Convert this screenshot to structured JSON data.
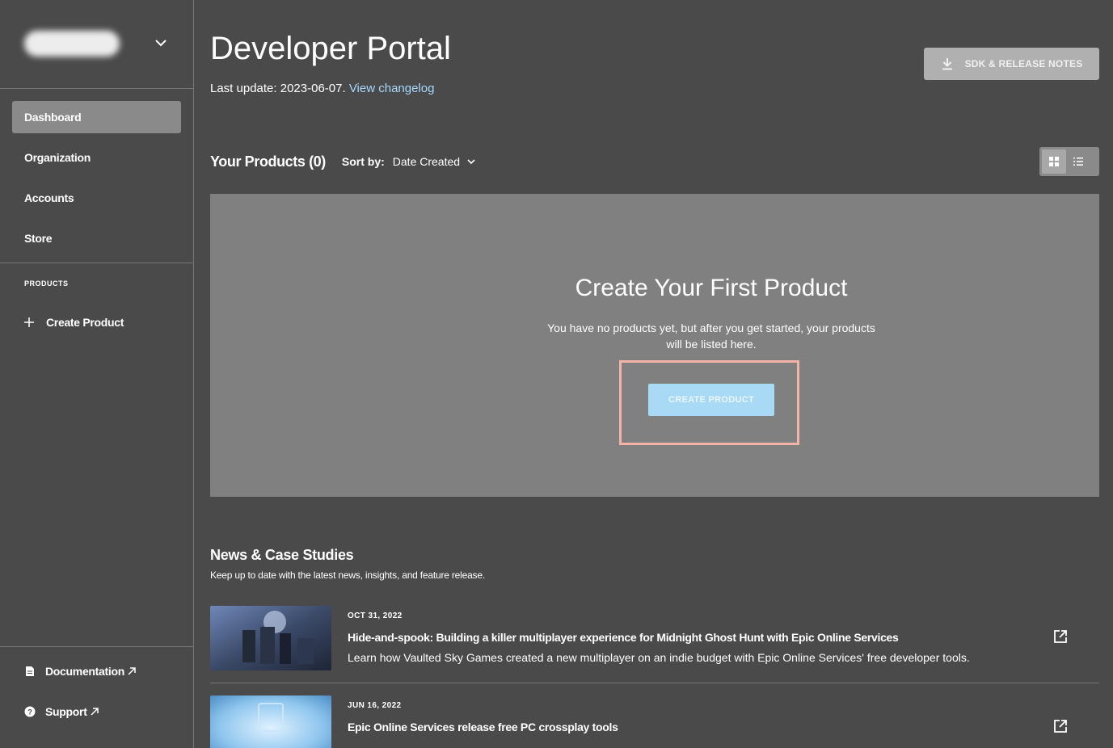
{
  "sidebar": {
    "nav": [
      {
        "label": "Dashboard",
        "active": true
      },
      {
        "label": "Organization"
      },
      {
        "label": "Accounts"
      },
      {
        "label": "Store"
      }
    ],
    "section_label": "PRODUCTS",
    "create_product": "Create Product",
    "documentation": "Documentation",
    "support": "Support"
  },
  "header": {
    "title": "Developer Portal",
    "last_update_prefix": "Last update: 2023-06-07.",
    "changelog_link": "View changelog",
    "sdk_button": "SDK & RELEASE NOTES"
  },
  "products": {
    "title": "Your Products (0)",
    "sort_label": "Sort by:",
    "sort_value": "Date Created"
  },
  "empty_state": {
    "title": "Create Your First Product",
    "text": "You have no products yet, but after you get started, your products will be listed here.",
    "button": "CREATE PRODUCT"
  },
  "news": {
    "title": "News & Case Studies",
    "subtitle": "Keep up to date with the latest news, insights, and feature release.",
    "items": [
      {
        "date": "OCT 31, 2022",
        "headline": "Hide-and-spook: Building a killer multiplayer experience for Midnight Ghost Hunt with Epic Online Services",
        "description": "Learn how Vaulted Sky Games created a new multiplayer on an indie budget with Epic Online Services' free developer tools."
      },
      {
        "date": "JUN 16, 2022",
        "headline": "Epic Online Services release free PC crossplay tools",
        "description": ""
      }
    ]
  },
  "colors": {
    "background": "#4a4a4a",
    "panel": "#808080",
    "accent_link": "#a7d8ff",
    "create_button": "#a8d9f5",
    "highlight_border": "#f4b3a6"
  }
}
